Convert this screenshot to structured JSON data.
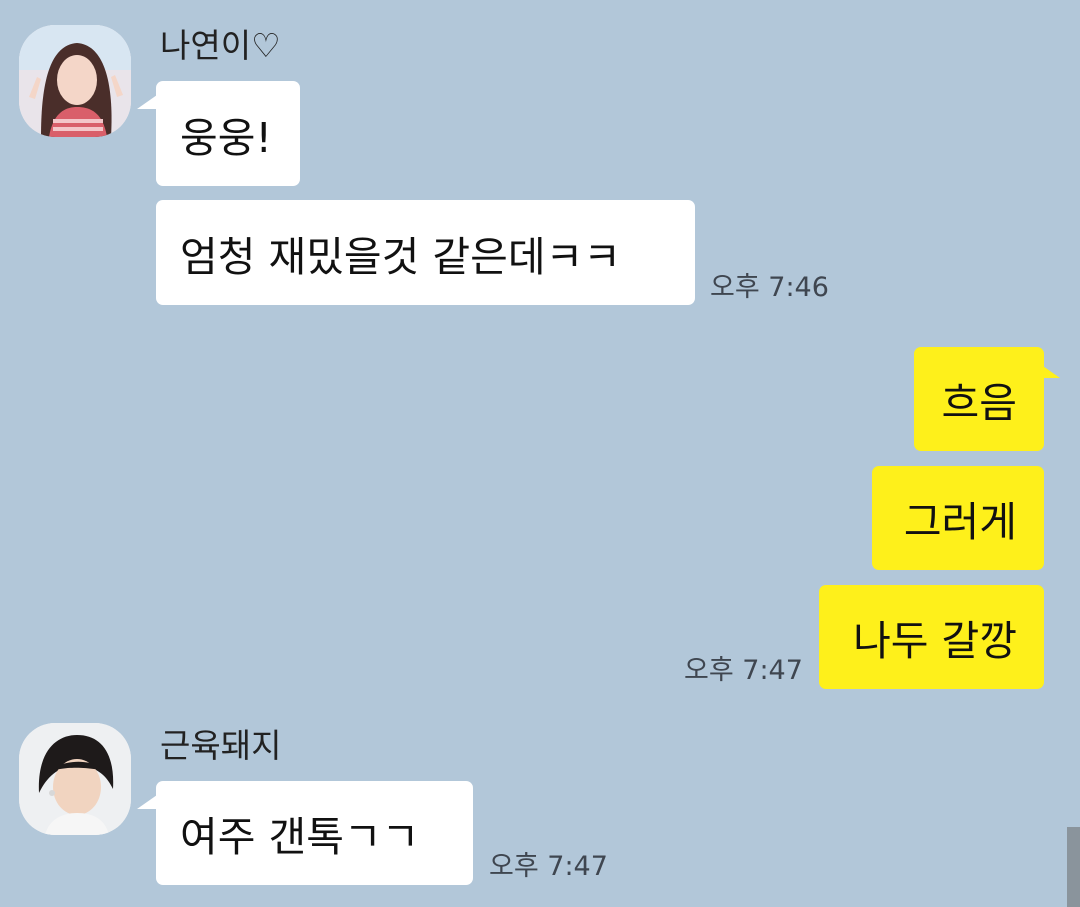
{
  "chat": {
    "groups": [
      {
        "sender": "나연이♡",
        "avatar_icon": "profile-photo-woman-icon",
        "messages": [
          "웅웅!",
          "엄청 재밌을것 같은데ㅋㅋ"
        ],
        "time": "오후 7:46"
      },
      {
        "sender": "me",
        "messages": [
          "흐음",
          "그러게",
          "나두 갈깡"
        ],
        "time": "오후 7:47"
      },
      {
        "sender": "근육돼지",
        "avatar_icon": "profile-photo-man-icon",
        "messages": [
          "여주 갠톡ㄱㄱ"
        ],
        "time": "오후 7:47"
      }
    ]
  },
  "colors": {
    "background": "#b2c7d9",
    "incoming_bubble": "#ffffff",
    "outgoing_bubble": "#fef01b",
    "timestamp_text": "#3f4650"
  }
}
